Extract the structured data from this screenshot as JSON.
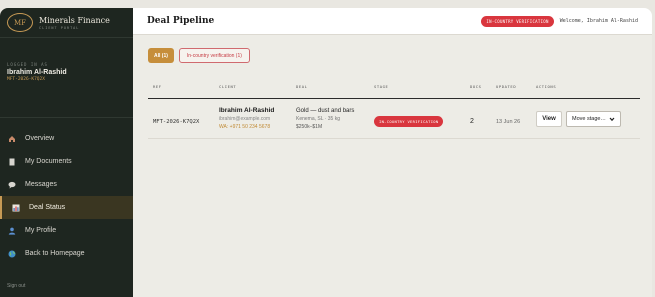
{
  "brand": {
    "logo_text": "MF",
    "name": "Minerals Finance",
    "subtitle": "CLIENT PORTAL"
  },
  "user": {
    "caption": "LOGGED IN AS",
    "name": "Ibrahim Al-Rashid",
    "ref": "MFT-2026-K7Q2X"
  },
  "sidebar": {
    "items": [
      {
        "label": "Overview",
        "icon": "home-icon",
        "active": false
      },
      {
        "label": "My Documents",
        "icon": "document-icon",
        "active": false
      },
      {
        "label": "Messages",
        "icon": "chat-icon",
        "active": false
      },
      {
        "label": "Deal Status",
        "icon": "chart-icon",
        "active": true
      },
      {
        "label": "My Profile",
        "icon": "user-icon",
        "active": false
      },
      {
        "label": "Back to Homepage",
        "icon": "globe-icon",
        "active": false
      }
    ],
    "signout": "Sign out"
  },
  "header": {
    "title": "Deal Pipeline",
    "status_badge": "IN-COUNTRY VERIFICATION",
    "welcome": "Welcome, Ibrahim Al-Rashid"
  },
  "filters": {
    "all": "All (1)",
    "verification": "In-country verification (1)"
  },
  "table": {
    "columns": [
      "REF",
      "CLIENT",
      "DEAL",
      "STAGE",
      "DOCS",
      "UPDATED",
      "ACTIONS"
    ],
    "rows": [
      {
        "ref": "MFT-2026-K7Q2X",
        "client_name": "Ibrahim Al-Rashid",
        "client_email": "ibrahim@example.com",
        "client_wa": "WA: +971 50 234 5678",
        "deal_title": "Gold — dust and bars",
        "deal_location": "Kenema, SL · 35 kg",
        "deal_value": "$250k–$1M",
        "stage": "IN-COUNTRY VERIFICATION",
        "docs": "2",
        "updated": "13 Jun 26",
        "view_label": "View",
        "move_label": "Move stage…"
      }
    ]
  },
  "colors": {
    "accent": "#c68e3b",
    "status_red": "#d9363e",
    "sidebar_bg": "#1e2620"
  }
}
